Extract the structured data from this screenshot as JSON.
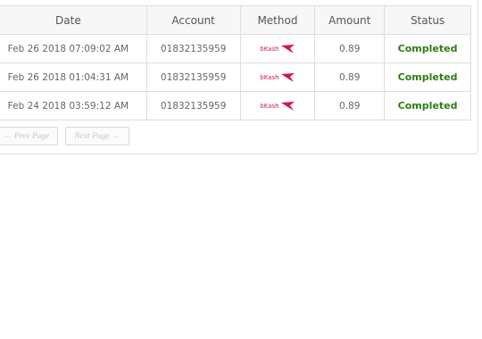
{
  "table": {
    "headers": {
      "date": "Date",
      "account": "Account",
      "method": "Method",
      "amount": "Amount",
      "status": "Status"
    },
    "rows": [
      {
        "date": "Feb 26 2018 07:09:02 AM",
        "account": "01832135959",
        "method": "bKash",
        "amount": "0.89",
        "status": "Completed"
      },
      {
        "date": "Feb 26 2018 01:04:31 AM",
        "account": "01832135959",
        "method": "bKash",
        "amount": "0.89",
        "status": "Completed"
      },
      {
        "date": "Feb 24 2018 03:59:12 AM",
        "account": "01832135959",
        "method": "bKash",
        "amount": "0.89",
        "status": "Completed"
      }
    ]
  },
  "pagination": {
    "prev_label": "← Prev Page",
    "next_label": "Next Page →"
  },
  "colors": {
    "status_completed": "#2e7d15",
    "bkash_brand": "#d2145a"
  },
  "icons": {
    "method_logo": "bkash-logo-icon"
  }
}
